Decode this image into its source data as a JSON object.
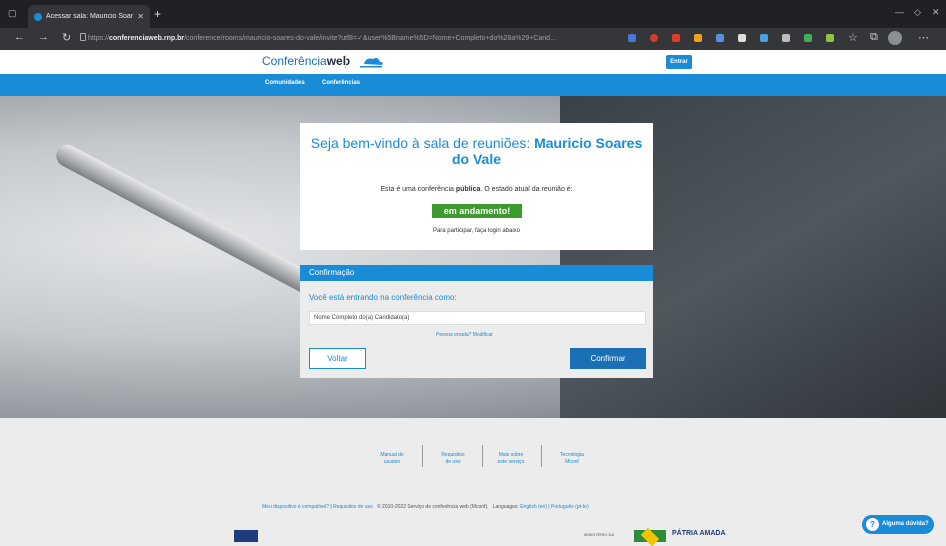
{
  "browser": {
    "tab_title": "Acessar sala: Mauricio Soares do...",
    "url_prefix": "https://",
    "url_domain": "conferenciaweb.rnp.br",
    "url_path": "/conference/rooms/mauricio-soares-do-vale/invite?utf8=✓&user%5Bname%5D=Nome+Completo+do%28a%29+Cand..."
  },
  "header": {
    "logo_text_light": "Conferência",
    "logo_text_bold": "web",
    "login_button": "Entrar"
  },
  "nav": [
    "Comunidades",
    "Conferências"
  ],
  "welcome": {
    "title_prefix": "Seja bem-vindo à sala de reuniões: ",
    "room_name": "Mauricio Soares do Vale",
    "status_prefix": "Esta é uma conferência ",
    "status_bold": "pública",
    "status_suffix": ". O estado atual da reunião é:",
    "status_badge": "em andamento!",
    "login_hint": "Para participar, faça login abaixo"
  },
  "confirmation": {
    "heading": "Confirmação",
    "label": "Você está entrando na conferência como:",
    "name_value": "Nome Completo do(a) Candidato(a)",
    "wrong_person": "Pessoa errada? Modificar",
    "back_button": "Voltar",
    "confirm_button": "Confirmar"
  },
  "footer": {
    "links": [
      {
        "l1": "Manual do",
        "l2": "usuário"
      },
      {
        "l1": "Requisitos",
        "l2": "de uso"
      },
      {
        "l1": "Mais sobre",
        "l2": "este serviço"
      },
      {
        "l1": "Tecnologia",
        "l2": "Mconf"
      }
    ],
    "compat": "Meu dispositivo é compatível?",
    "requisitos": "Requisitos de uso",
    "copyright": "© 2010-2022 Serviço de conferência web (Mconf).",
    "languages_label": "Languages:",
    "lang_en": "English (en)",
    "lang_pt": "Português (pt-br)",
    "help_button": "Alguma dúvida?",
    "gov_ministry": "MINISTÉRIO DA",
    "gov_slogan": "PÁTRIA AMADA"
  },
  "colors": {
    "accent": "#1a8bd6",
    "status": "#3c9a2e",
    "primary_button": "#1a6fb5"
  }
}
